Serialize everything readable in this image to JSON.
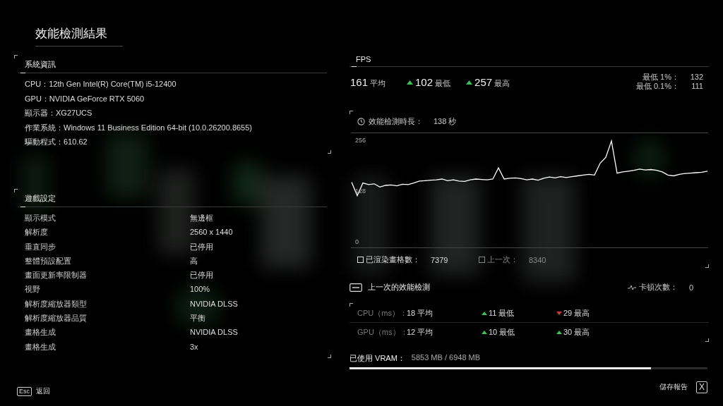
{
  "title": "效能檢測結果",
  "system_info": {
    "heading": "系統資訊",
    "items": [
      "CPU：12th Gen Intel(R) Core(TM) i5-12400",
      "GPU：NVIDIA GeForce RTX 5060",
      "顯示器：XG27UCS",
      "作業系統：Windows 11 Business Edition 64-bit (10.0.26200.8655)",
      "驅動程式：610.62"
    ]
  },
  "game_settings": {
    "heading": "遊戲設定",
    "rows": [
      {
        "label": "顯示模式",
        "value": "無邊框"
      },
      {
        "label": "解析度",
        "value": "2560 x 1440"
      },
      {
        "label": "垂直同步",
        "value": "已停用"
      },
      {
        "label": "整體預設配置",
        "value": "高"
      },
      {
        "label": "畫面更新率限制器",
        "value": "已停用"
      },
      {
        "label": "視野",
        "value": "100%"
      },
      {
        "label": "解析度縮放器類型",
        "value": "NVIDIA DLSS"
      },
      {
        "label": "解析度縮放器品質",
        "value": "平衡"
      },
      {
        "label": "畫格生成",
        "value": "NVIDIA DLSS"
      },
      {
        "label": "畫格生成",
        "value": "3x"
      }
    ]
  },
  "fps": {
    "stats": [
      {
        "value": "161",
        "label": "平均"
      },
      {
        "value": "102",
        "label": "最低",
        "up": true
      },
      {
        "value": "257",
        "label": "最高",
        "up": true
      }
    ],
    "lows": [
      {
        "label": "最低 1%：",
        "value": "132"
      },
      {
        "label": "最低 0.1%：",
        "value": "111"
      }
    ],
    "duration_label": "效能檢測時長：",
    "duration_value": "138 秒",
    "chart_data": {
      "type": "line",
      "ylim": [
        0,
        256
      ],
      "yticks": [
        0,
        128,
        256
      ],
      "series": [
        {
          "name": "FPS",
          "color": "#ffffff",
          "values": [
            152,
            118,
            150,
            146,
            148,
            140,
            144,
            145,
            143,
            147,
            146,
            150,
            155,
            156,
            157,
            158,
            160,
            156,
            158,
            155,
            154,
            158,
            160,
            159,
            158,
            160,
            188,
            160,
            162,
            163,
            161,
            158,
            160,
            157,
            162,
            165,
            163,
            166,
            164,
            166,
            168,
            170,
            172,
            170,
            200,
            215,
            256,
            175,
            178,
            180,
            182,
            185,
            183,
            184,
            182,
            178,
            170,
            168,
            172,
            174,
            175,
            176,
            177,
            180
          ]
        }
      ]
    },
    "legend": [
      {
        "label": "已渲染畫格數：",
        "value": "7379",
        "disabled": false
      },
      {
        "label": "上一次：",
        "value": "8340",
        "disabled": true
      }
    ]
  },
  "previous": {
    "label": "上一次的效能檢測",
    "stutter_label": "卡頓次數：",
    "stutter_value": "0"
  },
  "timings": [
    {
      "label": "CPU（ms）：",
      "avg": "18 平均",
      "min": "11 最低",
      "min_up": true,
      "max": "29 最高",
      "max_up": false
    },
    {
      "label": "GPU（ms）：",
      "avg": "12 平均",
      "min": "10 最低",
      "min_up": true,
      "max": "30 最高",
      "max_up": true
    }
  ],
  "vram": {
    "label": "已使用 VRAM：",
    "value": "5853 MB / 6948 MB",
    "level": 0.842
  },
  "footer": {
    "back_key": "Esc",
    "back_label": "返回",
    "save_label": "儲存報告",
    "save_key": "X"
  }
}
